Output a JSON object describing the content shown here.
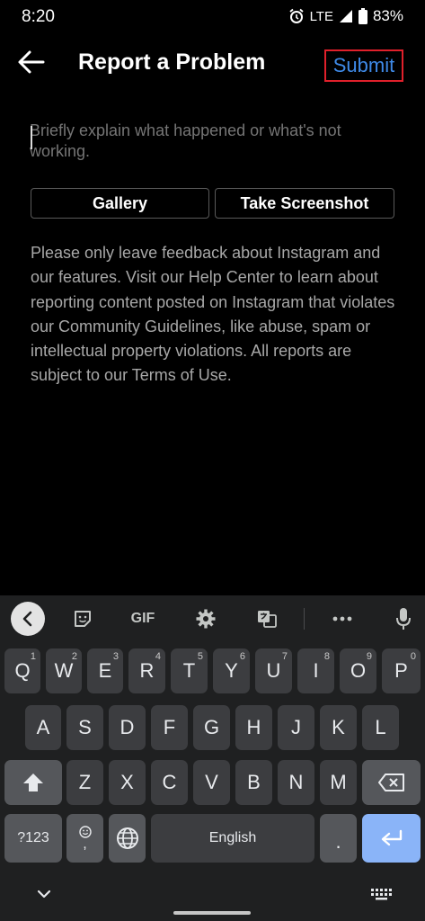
{
  "status_bar": {
    "time": "8:20",
    "network": "LTE",
    "battery": "83%",
    "icons": [
      "alarm-icon",
      "signal-icon",
      "battery-icon"
    ]
  },
  "app_bar": {
    "title": "Report a Problem",
    "submit_label": "Submit",
    "back_icon": "arrow-left-icon"
  },
  "form": {
    "description_placeholder": "Briefly explain what happened or what's not working.",
    "gallery_label": "Gallery",
    "screenshot_label": "Take Screenshot",
    "help_text": "Please only leave feedback about Instagram and our features. Visit our Help Center to learn about reporting content posted on Instagram that violates our Community Guidelines, like abuse, spam or intellectual property violations. All reports are subject to our Terms of Use."
  },
  "keyboard": {
    "toolbar": {
      "gif_label": "GIF",
      "icons": [
        "chevron-left-icon",
        "sticker-icon",
        "gif-icon",
        "gear-icon",
        "translate-icon",
        "more-icon",
        "mic-icon"
      ]
    },
    "row1": [
      {
        "label": "Q",
        "hint": "1"
      },
      {
        "label": "W",
        "hint": "2"
      },
      {
        "label": "E",
        "hint": "3"
      },
      {
        "label": "R",
        "hint": "4"
      },
      {
        "label": "T",
        "hint": "5"
      },
      {
        "label": "Y",
        "hint": "6"
      },
      {
        "label": "U",
        "hint": "7"
      },
      {
        "label": "I",
        "hint": "8"
      },
      {
        "label": "O",
        "hint": "9"
      },
      {
        "label": "P",
        "hint": "0"
      }
    ],
    "row2": [
      "A",
      "S",
      "D",
      "F",
      "G",
      "H",
      "J",
      "K",
      "L"
    ],
    "row3": [
      "Z",
      "X",
      "C",
      "V",
      "B",
      "N",
      "M"
    ],
    "symbols_label": "?123",
    "emoji_comma": ",",
    "space_label": "English",
    "period_label": ".",
    "colors": {
      "enter_key": "#8ab4f8",
      "key_bg": "#3c3d40",
      "keyboard_bg": "#1f2021"
    }
  },
  "colors": {
    "background": "#000000",
    "submit_text": "#3f8ae8",
    "submit_highlight": "#e0202b"
  }
}
